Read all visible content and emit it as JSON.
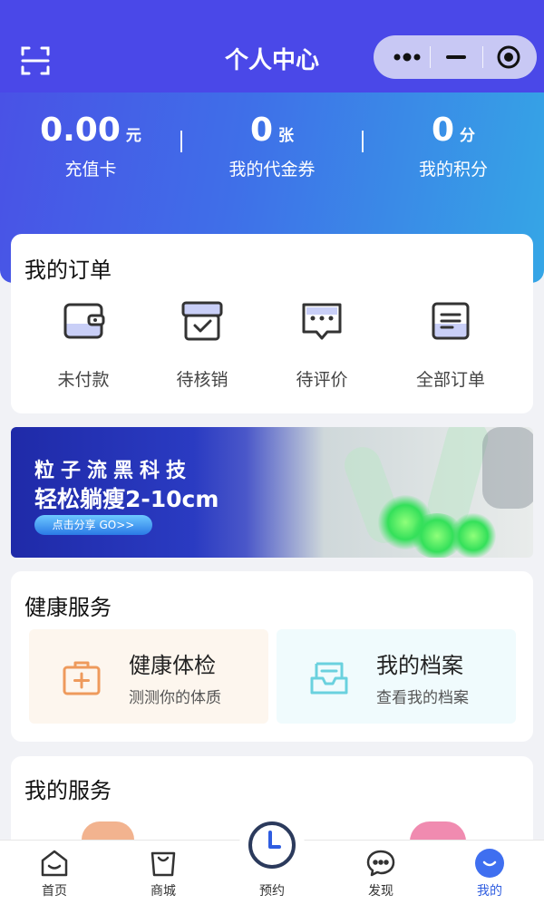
{
  "header": {
    "title": "个人中心",
    "scan_icon": "scan-icon",
    "capsule": {
      "more_icon": "more-dots-icon",
      "minimize_icon": "minimize-icon",
      "close_icon": "target-close-icon"
    }
  },
  "stats": [
    {
      "value": "0.00",
      "unit": "元",
      "label": "充值卡"
    },
    {
      "value": "0",
      "unit": "张",
      "label": "我的代金券"
    },
    {
      "value": "0",
      "unit": "分",
      "label": "我的积分"
    }
  ],
  "orders": {
    "title": "我的订单",
    "items": [
      {
        "label": "未付款",
        "icon": "wallet-icon"
      },
      {
        "label": "待核销",
        "icon": "box-check-icon"
      },
      {
        "label": "待评价",
        "icon": "comment-icon"
      },
      {
        "label": "全部订单",
        "icon": "list-doc-icon"
      }
    ]
  },
  "banner": {
    "line1": "粒子流黑科技",
    "line2": "轻松躺瘦2-10cm",
    "button": "点击分享 GO>>"
  },
  "health": {
    "title": "健康服务",
    "items": [
      {
        "title": "健康体检",
        "subtitle": "测测你的体质",
        "icon": "medical-kit-icon",
        "bg": "#fdf6ee",
        "color": "#ee9a5c"
      },
      {
        "title": "我的档案",
        "subtitle": "查看我的档案",
        "icon": "archive-tray-icon",
        "bg": "#f0fbfd",
        "color": "#6ad1de"
      }
    ]
  },
  "services": {
    "title": "我的服务"
  },
  "tabbar": [
    {
      "label": "首页",
      "icon": "home-icon"
    },
    {
      "label": "商城",
      "icon": "shopping-bag-icon"
    },
    {
      "label": "预约",
      "icon": "clock-icon"
    },
    {
      "label": "发现",
      "icon": "chat-bubble-icon"
    },
    {
      "label": "我的",
      "icon": "smile-face-icon",
      "active": true
    }
  ],
  "colors": {
    "primary": "#4a48e8",
    "accent": "#2f5de0",
    "gradient_end": "#35a6e6"
  }
}
